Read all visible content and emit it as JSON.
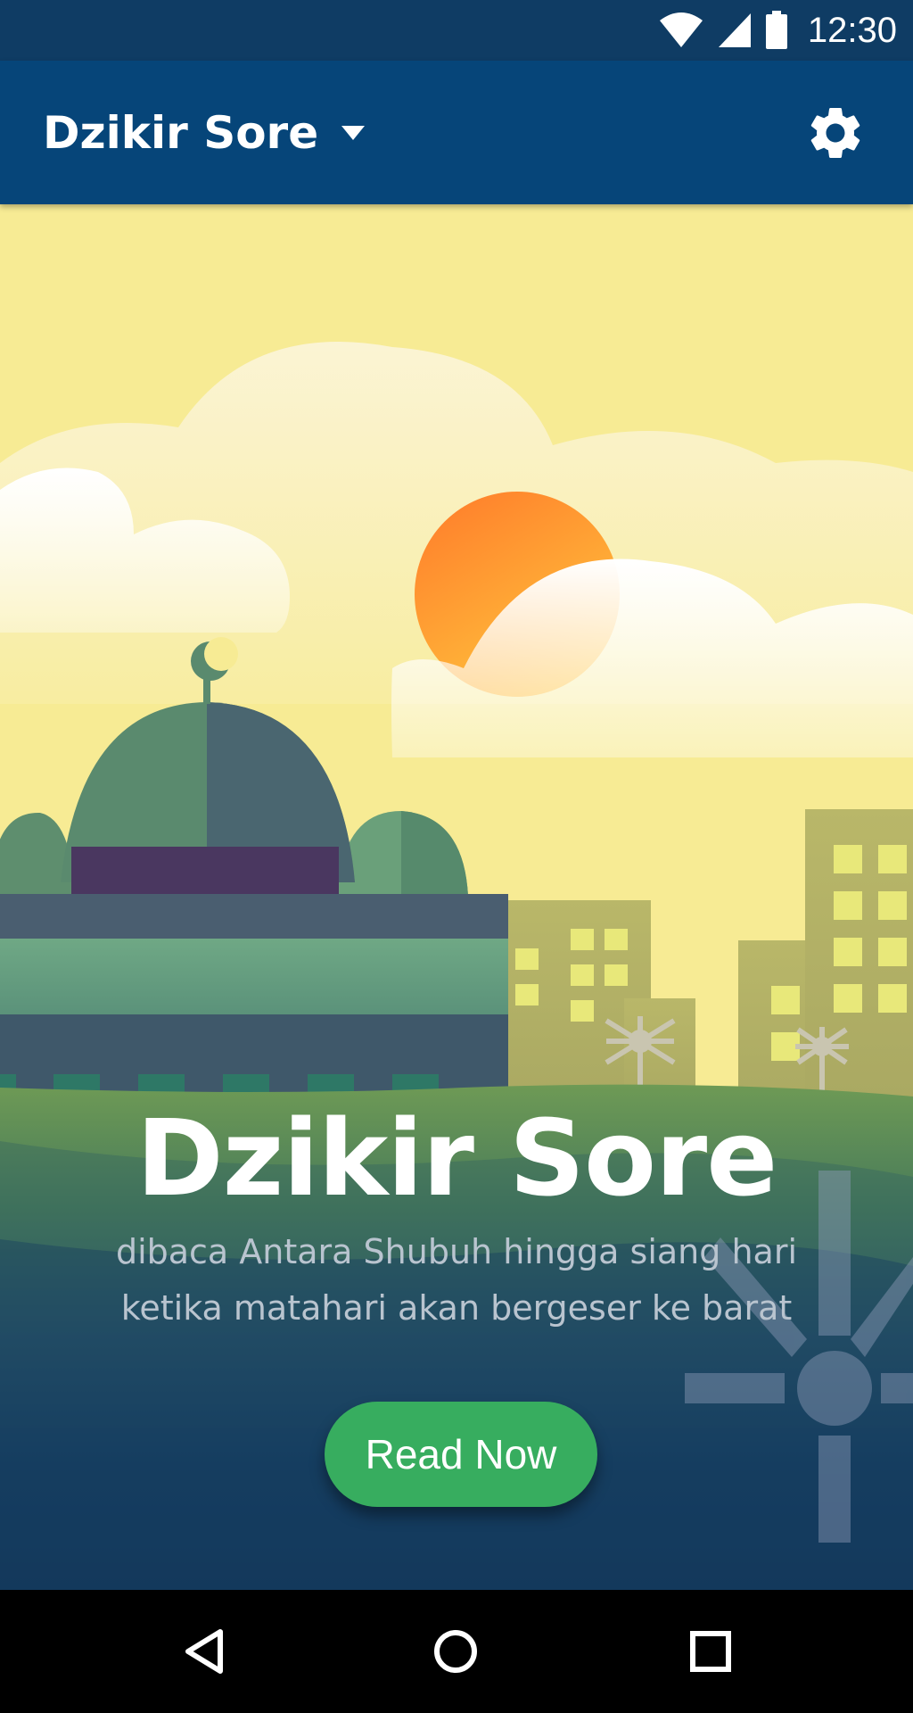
{
  "status_bar": {
    "time": "12:30",
    "icons": [
      "wifi-icon",
      "signal-icon",
      "battery-icon"
    ]
  },
  "app_bar": {
    "title": "Dzikir Sore",
    "dropdown_icon": "caret-down-icon",
    "settings_icon": "gear-icon"
  },
  "hero": {
    "title": "Dzikir Sore",
    "subtitle_line1": "dibaca Antara Shubuh hingga siang hari",
    "subtitle_line2": "ketika matahari akan bergeser ke barat",
    "button_label": "Read Now"
  },
  "nav_bar": {
    "icons": [
      "back-triangle-icon",
      "home-circle-icon",
      "recents-square-icon"
    ]
  },
  "colors": {
    "status_bar": "#0f3c64",
    "app_bar": "#064579",
    "sky": "#f7eb94",
    "sun": "#ff8a2e",
    "button": "#37ad5f",
    "ground_dark": "#0a2a55"
  }
}
